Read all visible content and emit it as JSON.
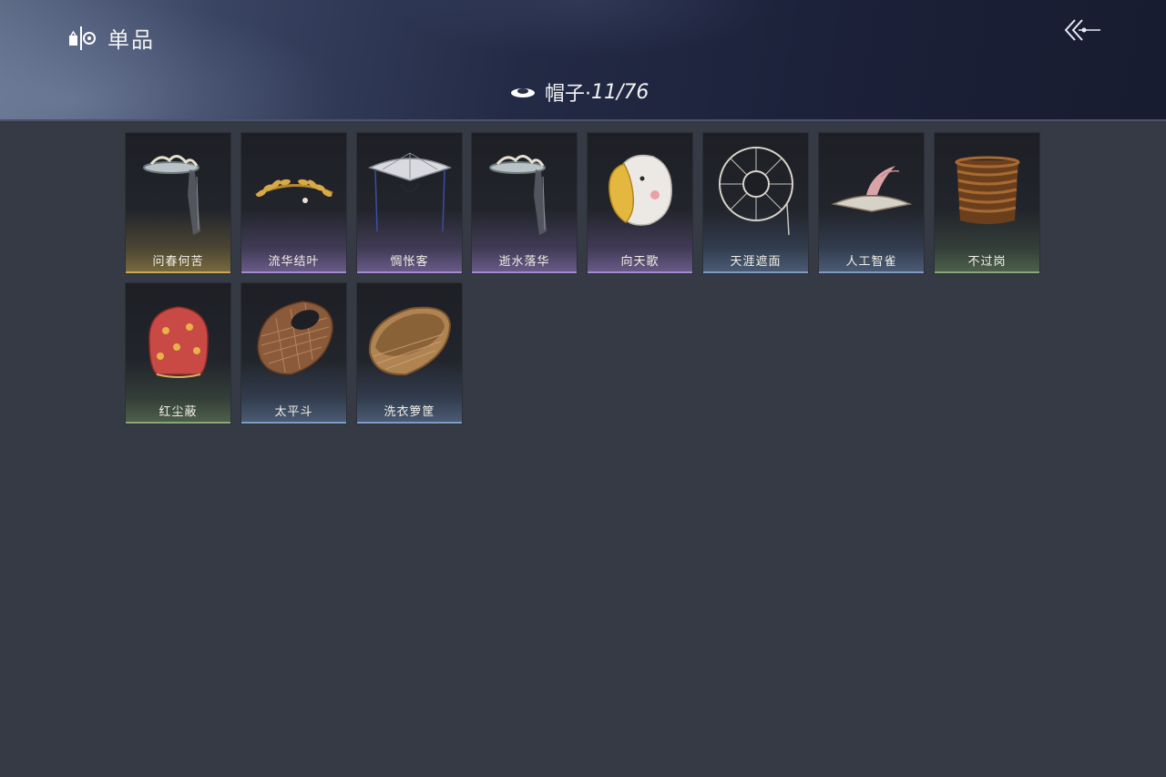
{
  "header": {
    "title": "单品",
    "icon": "outfit-icon",
    "back_icon": "back-arrow-icon"
  },
  "category": {
    "icon": "hat-icon",
    "label": "帽子·",
    "count": "11/76"
  },
  "items": [
    {
      "name": "问春何苦",
      "rarity": "gold",
      "icon": "veiled-hat-icon"
    },
    {
      "name": "流华结叶",
      "rarity": "purple",
      "icon": "laurel-crown-icon"
    },
    {
      "name": "惆怅客",
      "rarity": "purple",
      "icon": "bamboo-hat-icon"
    },
    {
      "name": "逝水落华",
      "rarity": "purple",
      "icon": "veiled-hat-icon"
    },
    {
      "name": "向天歌",
      "rarity": "purple",
      "icon": "goose-hood-icon"
    },
    {
      "name": "天涯遮面",
      "rarity": "blue",
      "icon": "wire-hat-icon"
    },
    {
      "name": "人工智雀",
      "rarity": "blue",
      "icon": "bird-hat-icon"
    },
    {
      "name": "不过岗",
      "rarity": "green",
      "icon": "bowl-stack-icon"
    },
    {
      "name": "红尘蔽",
      "rarity": "green",
      "icon": "red-hood-icon"
    },
    {
      "name": "太平斗",
      "rarity": "blue",
      "icon": "wicker-hat-icon"
    },
    {
      "name": "洗衣箩筐",
      "rarity": "blue",
      "icon": "basket-icon"
    }
  ]
}
